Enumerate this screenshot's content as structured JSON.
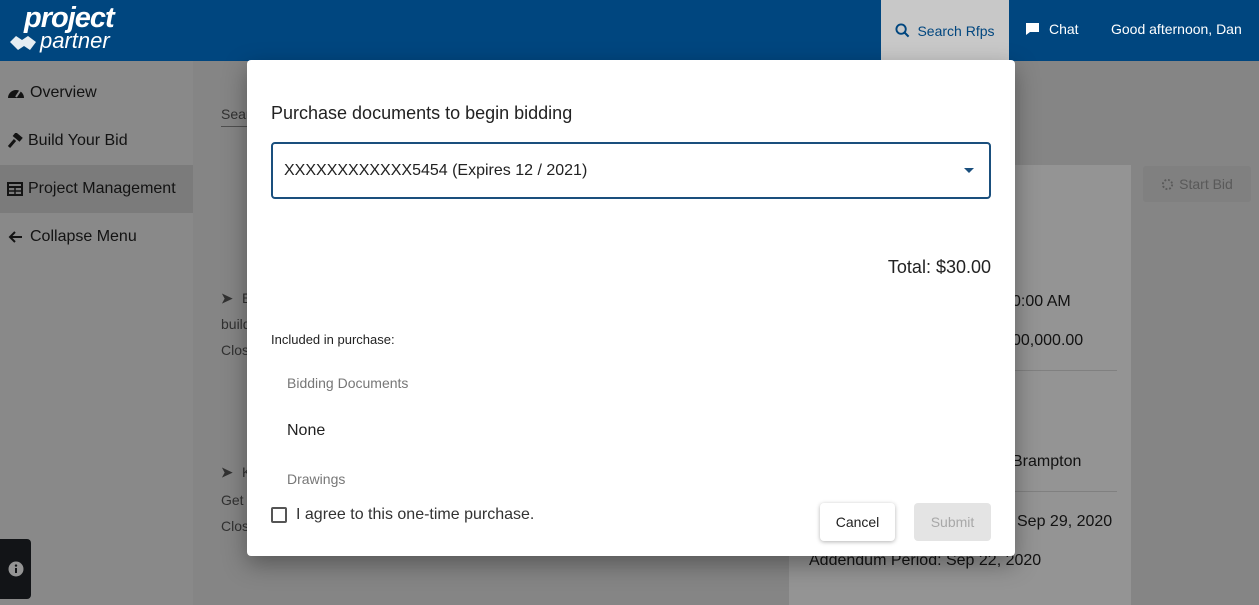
{
  "header": {
    "logo_line1": "project",
    "logo_line2": "partner",
    "search_label": "Search Rfps",
    "chat_label": "Chat",
    "greeting": "Good afternoon, Dan"
  },
  "sidebar": {
    "items": [
      {
        "label": "Overview",
        "icon": "speedometer-icon"
      },
      {
        "label": "Build Your Bid",
        "icon": "hammer-icon"
      },
      {
        "label": "Project Management",
        "icon": "table-icon",
        "active": true
      },
      {
        "label": "Collapse Menu",
        "icon": "arrow-left-icon"
      }
    ]
  },
  "background": {
    "search_placeholder_fragment": "Sear",
    "card1_letter": "E",
    "card1_line1": "build",
    "card1_line2": "Clos",
    "card2_letter": "K",
    "card2_line1": "Get",
    "card2_line2": "Clos",
    "right_time": "0:00 AM",
    "right_amount": "00,000.00",
    "right_location": "Brampton",
    "right_date": "Sep 29, 2020",
    "right_addendum": "Addendum Period: Sep 22, 2020",
    "start_bid_label": "Start Bid"
  },
  "modal": {
    "title": "Purchase documents to begin bidding",
    "selected_card": "XXXXXXXXXXXX5454 (Expires 12 / 2021)",
    "total": "Total: $30.00",
    "included_label": "Included in purchase:",
    "docs": [
      {
        "label": "Bidding Documents",
        "value": "None"
      },
      {
        "label": "Drawings",
        "value": ""
      }
    ],
    "agree_label": "I agree to this one-time purchase.",
    "agree_checked": false,
    "cancel_label": "Cancel",
    "submit_label": "Submit"
  },
  "colors": {
    "brand": "#00467f",
    "overlay": "rgba(0,0,0,0.42)",
    "select_border": "#1a4f7d"
  }
}
